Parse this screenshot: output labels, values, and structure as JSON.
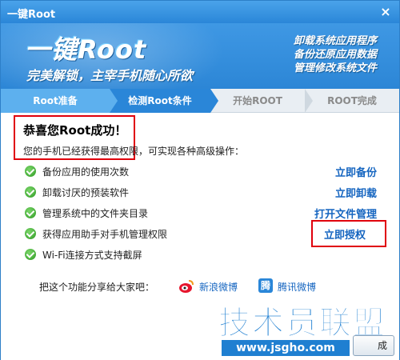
{
  "window": {
    "title": "一键Root",
    "close_symbol": "×"
  },
  "banner": {
    "logo": "一键Root",
    "slogan": "完美解锁，主宰手机随心所欲",
    "features": [
      "卸载系统应用程序",
      "备份还原应用数据",
      "管理修改系统文件"
    ]
  },
  "steps": [
    {
      "label": "Root准备"
    },
    {
      "label": "检测Root条件"
    },
    {
      "label": "开始ROOT"
    },
    {
      "label": "ROOT完成"
    }
  ],
  "content": {
    "congrats": "恭喜您Root成功！",
    "subtext": "您的手机已经获得最高权限，可实现各种高级操作：",
    "items": [
      {
        "label": "备份应用的使用次数",
        "action": "立即备份"
      },
      {
        "label": "卸载讨厌的预装软件",
        "action": "立即卸载"
      },
      {
        "label": "管理系统中的文件夹目录",
        "action": "打开文件管理"
      },
      {
        "label": "获得应用助手对手机管理权限",
        "action": "立即授权"
      },
      {
        "label": "Wi-Fi连接方式支持截屏",
        "action": ""
      }
    ],
    "share_prompt": "把这个功能分享给大家吧：",
    "share_weibo": "新浪微博",
    "share_tencent": "腾讯微博"
  },
  "watermark": {
    "text": "技术员联盟",
    "url": "www.jsgho.com"
  },
  "footer": {
    "finish_button": "成"
  },
  "colors": {
    "accent": "#2a86d8",
    "highlight_border": "#e0000c",
    "link": "#1565c0"
  }
}
